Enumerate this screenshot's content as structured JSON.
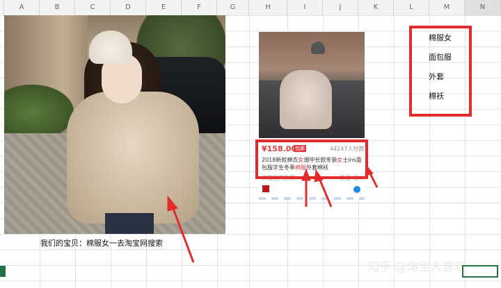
{
  "columns": [
    "A",
    "B",
    "C",
    "D",
    "E",
    "F",
    "G",
    "H",
    "I",
    "J",
    "K",
    "L",
    "M",
    "N"
  ],
  "caption": "我们的宝贝：棉服女一去淘宝网搜索",
  "product": {
    "price": "¥158.00",
    "badge": "包邮",
    "sold": "44247人付款",
    "title_parts": [
      "2018新款棉衣",
      "女",
      "潮中长款冬装",
      "女",
      "士ins面包服学生冬季",
      "棉服",
      "外套棉袄"
    ],
    "footer_left": "天猫官方旗舰...",
    "footer_right": "浙江 杭州"
  },
  "keywords": [
    "棉服女",
    "面包服",
    "外套",
    "棉袄"
  ],
  "watermark": "知乎 @淘宝人喜欢",
  "colors": {
    "annotation_red": "#e32b2b",
    "price_red": "#e4393c",
    "excel_green": "#217346"
  }
}
